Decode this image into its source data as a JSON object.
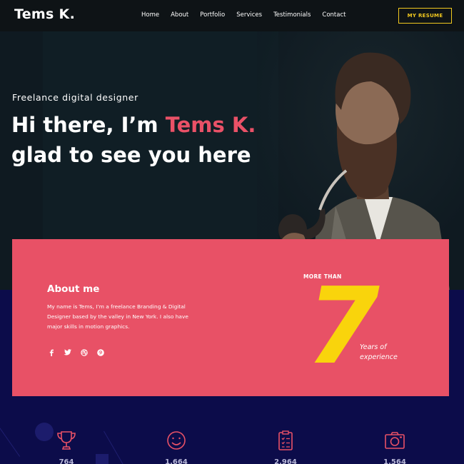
{
  "brand": {
    "logo": "Tems K."
  },
  "nav": {
    "items": [
      "Home",
      "About",
      "Portfolio",
      "Services",
      "Testimonials",
      "Contact"
    ],
    "cta": "MY RESUME"
  },
  "hero": {
    "kicker": "Freelance digital designer",
    "headline_part1": "Hi there, I’m ",
    "headline_name": "Tems K.",
    "headline_line2": "glad to see you here"
  },
  "about": {
    "title": "About me",
    "text": "My name is Tems, I’m a freelance Branding & Digital Designer based by the valley in New York. I also have major skills in motion graphics.",
    "socials": [
      "facebook-icon",
      "twitter-icon",
      "dribbble-icon",
      "pinterest-icon"
    ],
    "more_than": "MORE THAN",
    "years_number": "7",
    "years_label_1": "Years of",
    "years_label_2": "experience"
  },
  "stats": [
    {
      "icon": "trophy-icon",
      "value": "764"
    },
    {
      "icon": "smile-icon",
      "value": "1,664"
    },
    {
      "icon": "clipboard-icon",
      "value": "2,964"
    },
    {
      "icon": "camera-icon",
      "value": "1,564"
    }
  ],
  "colors": {
    "accent": "#e85166",
    "yellow": "#f9d40c",
    "navy": "#0c0c4a",
    "dark": "#0f1a21"
  }
}
